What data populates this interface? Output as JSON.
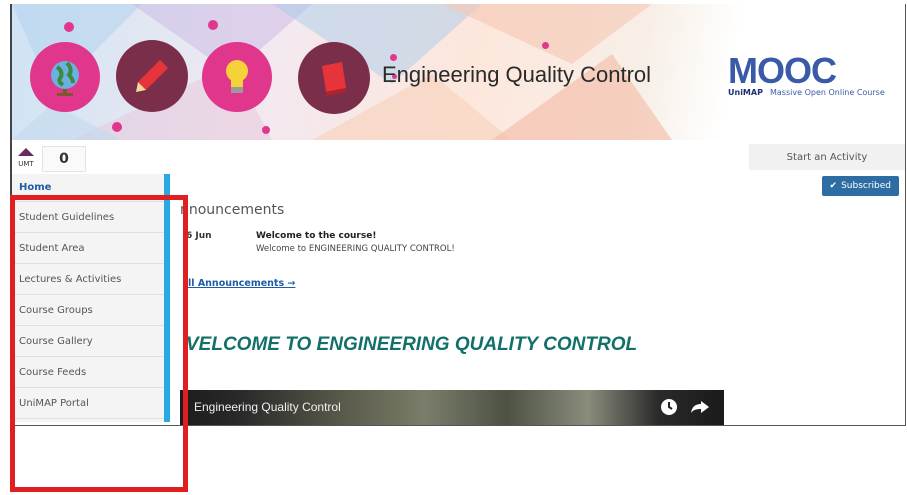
{
  "banner": {
    "title": "Engineering Quality Control",
    "logo_text": "MOOC",
    "logo_subtext": "Massive Open Online Course",
    "logo_partner": "UniMAP"
  },
  "topbar": {
    "institution": "UMT",
    "count": "0",
    "start_activity": "Start an Activity",
    "subscribed": "Subscribed"
  },
  "sidebar": {
    "items": [
      {
        "label": "Home"
      },
      {
        "label": "Student Guidelines"
      },
      {
        "label": "Student Area"
      },
      {
        "label": "Lectures & Activities"
      },
      {
        "label": "Course Groups"
      },
      {
        "label": "Course Gallery"
      },
      {
        "label": "Course Feeds"
      },
      {
        "label": "UniMAP Portal"
      }
    ]
  },
  "announcements": {
    "title": "nnouncements",
    "date": "6 Jun",
    "headline": "Welcome to the course!",
    "body": "Welcome to ENGINEERING QUALITY CONTROL!",
    "link": "ll Announcements →"
  },
  "welcome_heading": "VELCOME TO ENGINEERING QUALITY CONTROL",
  "video": {
    "title": "Engineering Quality Control"
  },
  "colors": {
    "accent_blue": "#29a9e1",
    "button_blue": "#2e6da4",
    "heading_teal": "#127068",
    "highlight_red": "#e02020",
    "circle_pink": "#e0378d",
    "circle_maroon": "#7a2e4a"
  }
}
